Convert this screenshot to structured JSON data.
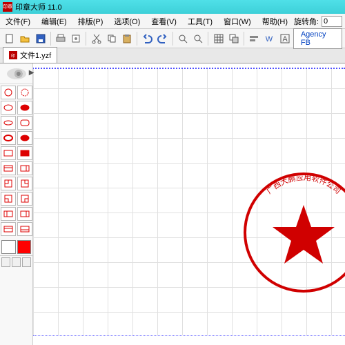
{
  "app": {
    "title": "印章大师 11.0",
    "logo_text": "印章"
  },
  "menu": {
    "file": "文件(F)",
    "edit": "编辑(E)",
    "layout": "排版(P)",
    "options": "选项(O)",
    "view": "查看(V)",
    "tools": "工具(T)",
    "window": "窗口(W)",
    "help": "帮助(H)",
    "rotate_label": "旋转角:",
    "rotate_value": "0"
  },
  "toolbar": {
    "font": "Agency FB",
    "icons": [
      "new",
      "open",
      "save",
      "print",
      "sep",
      "cut",
      "copy",
      "paste",
      "sep",
      "undo",
      "redo",
      "sep",
      "zoom-in",
      "zoom-out",
      "sep",
      "grid",
      "to-front",
      "sep",
      "align",
      "distribute",
      "word",
      "a-format"
    ]
  },
  "tab": {
    "filename": "文件1.yzf"
  },
  "palette": {
    "shapes": [
      "circle",
      "circle-dashed",
      "oval",
      "oval-hatched",
      "ellipse",
      "rounded-rect",
      "oval-bold",
      "oval-lines",
      "rect",
      "rect-fill",
      "rect-top",
      "rect-right",
      "square-tl",
      "square-tr",
      "square-bl",
      "square-br",
      "box-left",
      "box-right",
      "box-top",
      "box-bottom"
    ],
    "swatches": [
      "#ffffff",
      "#ff0000"
    ]
  },
  "stamp": {
    "text": "广西大鹏应用软件公司",
    "color": "#d00000"
  }
}
